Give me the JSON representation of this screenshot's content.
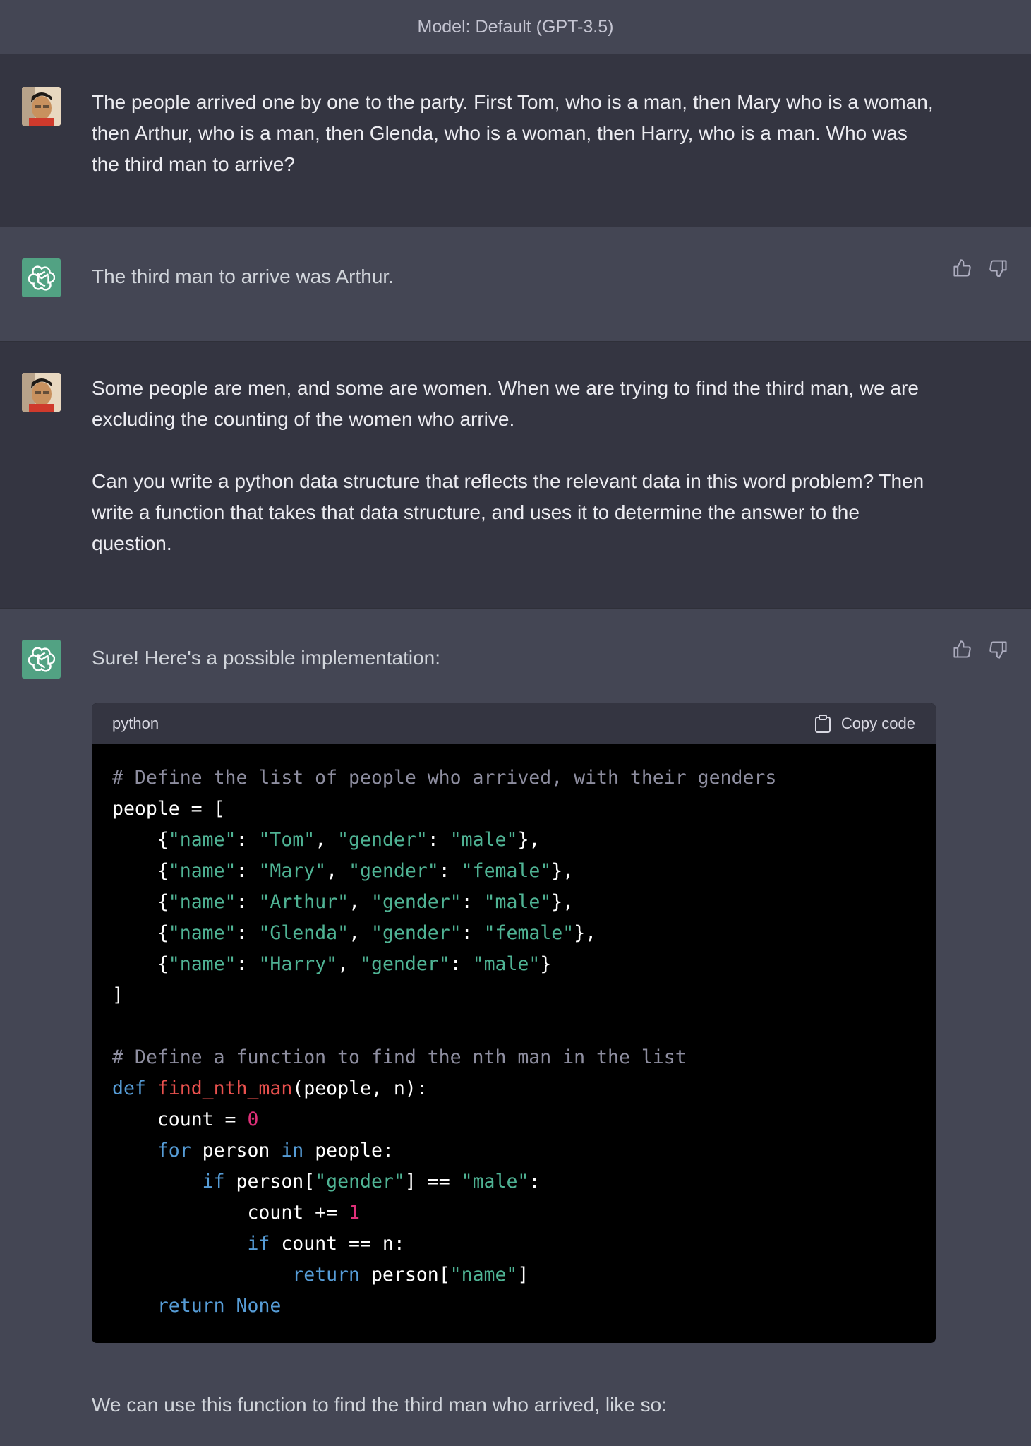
{
  "header": {
    "model_label": "Model: Default (GPT-3.5)"
  },
  "messages": [
    {
      "role": "user",
      "text": "The people arrived one by one to the party.  First Tom, who is a man, then Mary who is a woman, then Arthur, who is a man, then Glenda, who is a woman, then Harry, who is a man.  Who was the third man to arrive?"
    },
    {
      "role": "assistant",
      "text": "The third man to arrive was Arthur."
    },
    {
      "role": "user",
      "paragraphs": [
        "Some people are men, and some are women.  When we are trying to find the third man, we are excluding the counting of the women who arrive.",
        "Can you write a python data structure that reflects the relevant data in this word problem? Then write a function that takes that data structure, and uses it to determine the answer to the question."
      ]
    },
    {
      "role": "assistant",
      "intro": "Sure! Here's a possible implementation:",
      "code": {
        "language": "python",
        "copy_label": "Copy code"
      },
      "outro": "We can use this function to find the third man who arrived, like so:"
    }
  ],
  "code_lines": {
    "l1": "# Define the list of people who arrived, with their genders",
    "l2": "people = [",
    "tom_name": "\"Tom\"",
    "mary_name": "\"Mary\"",
    "arthur_name": "\"Arthur\"",
    "glenda_name": "\"Glenda\"",
    "harry_name": "\"Harry\"",
    "key_name": "\"name\"",
    "key_gender": "\"gender\"",
    "male": "\"male\"",
    "female": "\"female\"",
    "close_list": "]",
    "l9": "# Define a function to find the nth man in the list",
    "kw_def": "def",
    "fn_name": "find_nth_man",
    "fn_args": "(people, n):",
    "count_init": "count = ",
    "zero": "0",
    "kw_for": "for",
    "for_var": " person ",
    "kw_in": "in",
    "for_iter": " people:",
    "kw_if": "if",
    "if_expr": " person[",
    "if_expr2": "] == ",
    "colon": ":",
    "count_inc": "count += ",
    "one": "1",
    "if_count": " count == n:",
    "kw_return": "return",
    "ret_expr": " person[",
    "ret_close": "]",
    "kw_none": "None"
  },
  "icons": {
    "thumbs_up": "thumbs-up-icon",
    "thumbs_down": "thumbs-down-icon",
    "clipboard": "clipboard-icon",
    "openai": "openai-logo-icon"
  },
  "colors": {
    "user_bg": "#343541",
    "bot_bg": "#444654",
    "openai_green": "#52a283",
    "code_bg": "#000000"
  }
}
